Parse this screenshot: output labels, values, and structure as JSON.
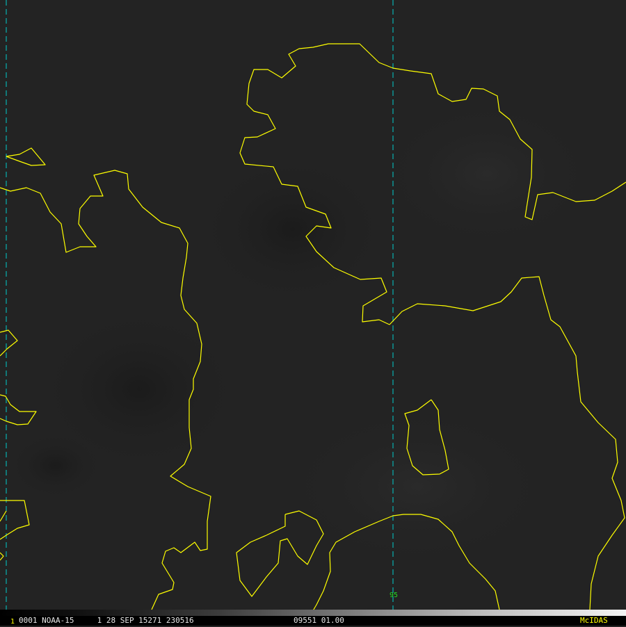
{
  "status_bar": {
    "frame_number": "1",
    "left_info": "0001 NOAA-15     1 28 SEP 15271 230516",
    "mid_info": "09551 01.00",
    "brand": "McIDAS"
  },
  "grid_label": "95",
  "colors": {
    "background": "#232323",
    "coastline": "#ffff00",
    "grid_line": "#00cccc",
    "grid_label": "#22dd22",
    "status_text": "#e8e8e8"
  }
}
